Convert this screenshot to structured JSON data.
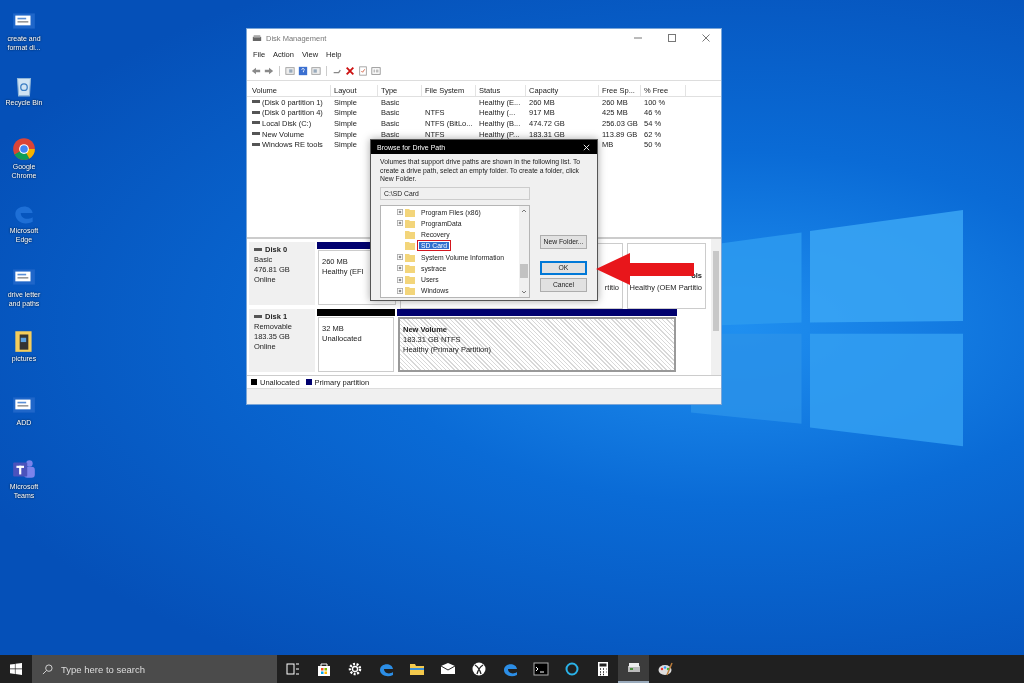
{
  "desktop_icons": [
    {
      "label": "create and format di...",
      "kind": "doc"
    },
    {
      "label": "Recycle Bin",
      "kind": "bin"
    },
    {
      "label": "Google Chrome",
      "kind": "chrome"
    },
    {
      "label": "Microsoft Edge",
      "kind": "edge"
    },
    {
      "label": "drive letter and paths",
      "kind": "doc"
    },
    {
      "label": "pictures",
      "kind": "folder"
    },
    {
      "label": "ADD",
      "kind": "doc"
    },
    {
      "label": "Microsoft Teams",
      "kind": "teams"
    }
  ],
  "window": {
    "title": "Disk Management",
    "menu": [
      "File",
      "Action",
      "View",
      "Help"
    ],
    "table": {
      "columns": [
        "Volume",
        "Layout",
        "Type",
        "File System",
        "Status",
        "Capacity",
        "Free Sp...",
        "% Free"
      ],
      "rows": [
        {
          "cells": [
            "(Disk 0 partition 1)",
            "Simple",
            "Basic",
            null,
            "Healthy (E...",
            "260 MB",
            "260 MB",
            "100 %"
          ]
        },
        {
          "cells": [
            "(Disk 0 partition 4)",
            "Simple",
            "Basic",
            "NTFS",
            "Healthy (...",
            "917 MB",
            "425 MB",
            "46 %"
          ]
        },
        {
          "cells": [
            "Local Disk (C:)",
            "Simple",
            "Basic",
            "NTFS (BitLo...",
            "Healthy (B...",
            "474.72 GB",
            "256.03 GB",
            "54 %"
          ]
        },
        {
          "cells": [
            "New Volume",
            "Simple",
            "Basic",
            "NTFS",
            "Healthy (P...",
            "183.31 GB",
            "113.89 GB",
            "62 %"
          ]
        },
        {
          "cells": [
            "Windows RE tools",
            "Simple",
            null,
            null,
            null,
            null,
            "MB",
            "50 %"
          ]
        }
      ]
    },
    "disks": [
      {
        "name": "Disk 0",
        "type": "Basic",
        "size": "476.81 GB",
        "state": "Online",
        "partitions": [
          {
            "kind": "primary",
            "selected": false,
            "lines": [
              "260 MB",
              "Healthy (EFI"
            ]
          },
          {
            "kind": "primary",
            "selected": false,
            "lines": [
              "rtitio"
            ]
          },
          {
            "kind": "primary",
            "selected": false,
            "title": "ols",
            "lines": [
              "Healthy (OEM Partitio"
            ]
          }
        ]
      },
      {
        "name": "Disk 1",
        "type": "Removable",
        "size": "183.35 GB",
        "state": "Online",
        "partitions": [
          {
            "kind": "unallocated",
            "selected": false,
            "lines": [
              "32 MB",
              "Unallocated"
            ]
          },
          {
            "kind": "primary",
            "selected": true,
            "title": "New Volume",
            "lines": [
              "183.31 GB NTFS",
              "Healthy (Primary Partition)"
            ]
          }
        ]
      }
    ],
    "legend": [
      {
        "kind": "unallocated",
        "label": "Unallocated"
      },
      {
        "kind": "primary",
        "label": "Primary partition"
      }
    ]
  },
  "dialog": {
    "title": "Browse for Drive Path",
    "description": "Volumes that support drive paths are shown in the following list. To create a drive path, select an empty folder. To create a folder, click New Folder.",
    "path": "C:\\SD Card",
    "folders": [
      {
        "label": "Program Files (x86)",
        "expandable": true,
        "selected": false,
        "annotated": false
      },
      {
        "label": "ProgramData",
        "expandable": true,
        "selected": false,
        "annotated": false
      },
      {
        "label": "Recovery",
        "expandable": false,
        "selected": false,
        "annotated": false
      },
      {
        "label": "SD Card",
        "expandable": false,
        "selected": true,
        "annotated": true
      },
      {
        "label": "System Volume Information",
        "expandable": true,
        "selected": false,
        "annotated": false
      },
      {
        "label": "systrace",
        "expandable": true,
        "selected": false,
        "annotated": false
      },
      {
        "label": "Users",
        "expandable": true,
        "selected": false,
        "annotated": false
      },
      {
        "label": "Windows",
        "expandable": true,
        "selected": false,
        "annotated": false
      }
    ],
    "buttons": [
      {
        "label": "New Folder...",
        "kind": "normal"
      },
      {
        "label": "OK",
        "kind": "default"
      },
      {
        "label": "Cancel",
        "kind": "normal"
      }
    ]
  },
  "taskbar": {
    "search": {
      "placeholder": "Type here to search"
    },
    "apps": [
      {
        "kind": "taskview",
        "selected": false
      },
      {
        "kind": "store",
        "selected": false
      },
      {
        "kind": "settings",
        "selected": false
      },
      {
        "kind": "edge",
        "selected": false
      },
      {
        "kind": "explorer",
        "selected": false
      },
      {
        "kind": "mail",
        "selected": false
      },
      {
        "kind": "xbox",
        "selected": false
      },
      {
        "kind": "edge",
        "selected": false
      },
      {
        "kind": "terminal",
        "selected": false
      },
      {
        "kind": "cortana",
        "selected": false
      },
      {
        "kind": "calculator",
        "selected": false
      },
      {
        "kind": "diskmgmt",
        "selected": true
      },
      {
        "kind": "paint",
        "selected": false
      }
    ]
  }
}
